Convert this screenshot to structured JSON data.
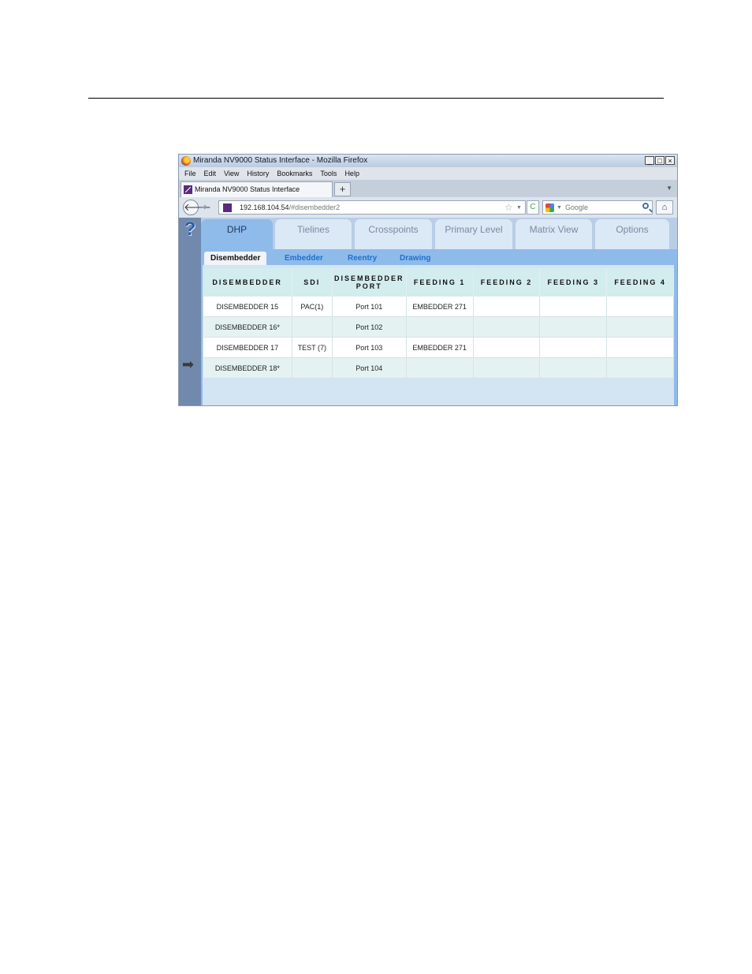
{
  "window": {
    "title": "Miranda NV9000 Status Interface - Mozilla Firefox",
    "buttons": {
      "minimize": "_",
      "maximize": "□",
      "close": "×"
    }
  },
  "menu": [
    "File",
    "Edit",
    "View",
    "History",
    "Bookmarks",
    "Tools",
    "Help"
  ],
  "browser_tab": {
    "label": "Miranda NV9000 Status Interface",
    "new_tab": "+"
  },
  "url": {
    "host": "192.168.104.54",
    "hash": "/#disembedder2"
  },
  "search": {
    "placeholder": "Google"
  },
  "main_tabs": [
    "DHP",
    "Tielines",
    "Crosspoints",
    "Primary Level",
    "Matrix View",
    "Options"
  ],
  "active_main_tab": "DHP",
  "sub_tabs": [
    "Disembedder",
    "Embedder",
    "Reentry",
    "Drawing"
  ],
  "active_sub_tab": "Disembedder",
  "table": {
    "headers": [
      "DISEMBEDDER",
      "SDI",
      "DISEMBEDDER PORT",
      "FEEDING 1",
      "FEEDING 2",
      "FEEDING 3",
      "FEEDING 4"
    ],
    "rows": [
      [
        "DISEMBEDDER 15",
        "PAC(1)",
        "Port 101",
        "EMBEDDER 271",
        "",
        "",
        ""
      ],
      [
        "DISEMBEDDER 16*",
        "",
        "Port 102",
        "",
        "",
        "",
        ""
      ],
      [
        "DISEMBEDDER 17",
        "TEST (7)",
        "Port 103",
        "EMBEDDER 271",
        "",
        "",
        ""
      ],
      [
        "DISEMBEDDER 18*",
        "",
        "Port 104",
        "",
        "",
        "",
        ""
      ]
    ]
  }
}
